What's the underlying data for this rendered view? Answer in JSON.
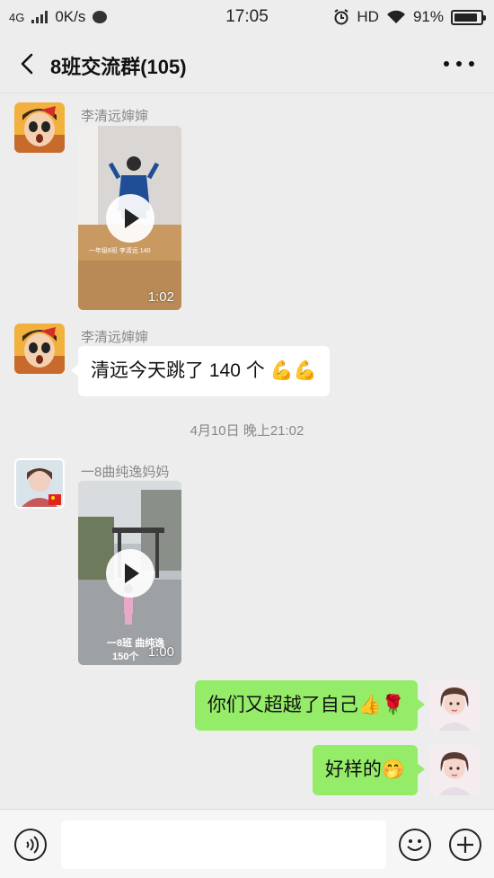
{
  "status_bar": {
    "network": "4G",
    "speed": "0K/s",
    "time": "17:05",
    "hd": "HD",
    "battery": "91%",
    "battery_level": 0.91
  },
  "header": {
    "title": "8班交流群(105)"
  },
  "messages": [
    {
      "sender": "李清远婶婶",
      "type": "video",
      "duration": "1:02",
      "caption": "一年级8班 李清远 140"
    },
    {
      "sender": "李清远婶婶",
      "type": "text",
      "text": "清远今天跳了 140 个 💪💪"
    },
    {
      "timestamp": "4月10日 晚上21:02"
    },
    {
      "sender": "一8曲纯逸妈妈",
      "type": "video",
      "duration": "1:00",
      "caption_line1": "一8班 曲纯逸",
      "caption_line2": "150个"
    },
    {
      "sender": "me",
      "type": "text",
      "text": "你们又超越了自己👍🌹"
    },
    {
      "sender": "me",
      "type": "text",
      "text": "好样的🤭"
    }
  ],
  "input_bar": {
    "voice_icon": "voice-icon",
    "emoji_icon": "emoji-icon",
    "plus_icon": "plus-icon"
  },
  "colors": {
    "background": "#ededed",
    "outgoing_bubble": "#95ec69",
    "incoming_bubble": "#ffffff"
  }
}
